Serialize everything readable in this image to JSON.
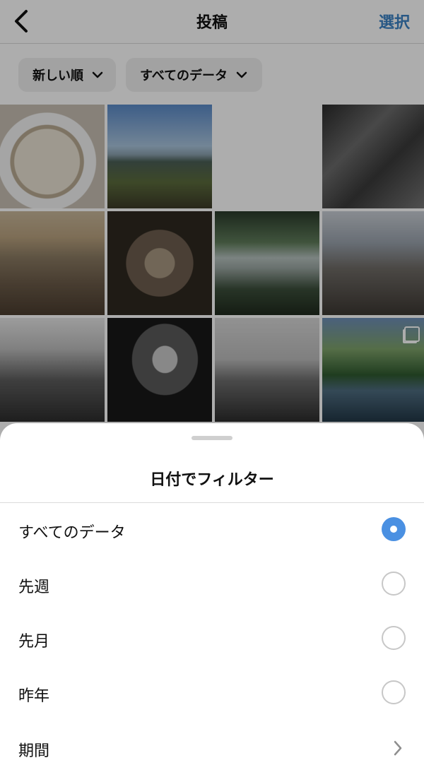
{
  "header": {
    "title": "投稿",
    "select_label": "選択"
  },
  "filters": {
    "sort_label": "新しい順",
    "data_label": "すべてのデータ"
  },
  "grid": {
    "thumbnails": [
      {
        "desc": "pasta-plate"
      },
      {
        "desc": "mountain-landscape"
      },
      {
        "desc": "blank"
      },
      {
        "desc": "machinery-closeup"
      },
      {
        "desc": "hillside-town"
      },
      {
        "desc": "butterfly"
      },
      {
        "desc": "lake-reflection"
      },
      {
        "desc": "factory-building"
      },
      {
        "desc": "snowy-forest"
      },
      {
        "desc": "man-portrait"
      },
      {
        "desc": "breakwater-blocks"
      },
      {
        "desc": "lakeside-cabin",
        "multi": true
      }
    ]
  },
  "sheet": {
    "title": "日付でフィルター",
    "options": [
      {
        "label": "すべてのデータ",
        "selected": true
      },
      {
        "label": "先週",
        "selected": false
      },
      {
        "label": "先月",
        "selected": false
      },
      {
        "label": "昨年",
        "selected": false
      },
      {
        "label": "期間",
        "selected": false
      }
    ]
  },
  "colors": {
    "accent": "#4a90e2",
    "select_text": "#3b82c4"
  }
}
